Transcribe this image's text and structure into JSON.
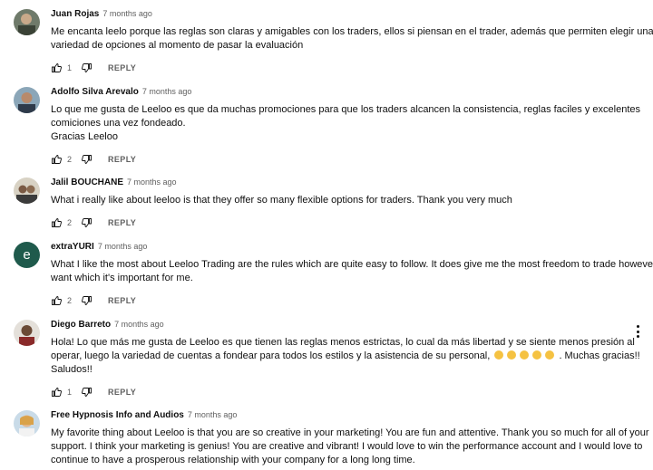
{
  "comments": [
    {
      "author": "Juan Rojas",
      "time": "7 months ago",
      "lines": [
        "Me encanta leelo porque las reglas son claras y amigables con los traders, ellos si piensan en el trader, además que permiten elegir una",
        "variedad de opciones al momento de pasar la evaluación"
      ],
      "likes": "1",
      "reply": "REPLY"
    },
    {
      "author": "Adolfo Silva Arevalo",
      "time": "7 months ago",
      "lines": [
        "Lo que me gusta de Leeloo es que da muchas promociones para que los traders alcancen la consistencia, reglas faciles y excelentes",
        "comiciones una vez fondeado.",
        "Gracias Leeloo"
      ],
      "likes": "2",
      "reply": "REPLY"
    },
    {
      "author": "Jalil BOUCHANE",
      "time": "7 months ago",
      "lines": [
        "What i really like about leeloo is that they offer so many flexible options for traders. Thank you very much"
      ],
      "likes": "2",
      "reply": "REPLY"
    },
    {
      "author": "extraYURI",
      "time": "7 months ago",
      "avatar_letter": "e",
      "lines": [
        "What I like the most about Leeloo Trading are the rules which are quite easy to follow. It does give me the most freedom to trade however I",
        "want which it's important for me."
      ],
      "likes": "2",
      "reply": "REPLY"
    },
    {
      "author": "Diego Barreto",
      "time": "7 months ago",
      "lines": [
        "Hola! Lo que más me gusta de Leeloo es que tienen las reglas menos estrictas, lo cual da más libertad y se siente menos presión al",
        "operar, luego la variedad de cuentas a fondear para todos los estilos y la asistencia de su personal,",
        "Saludos!!"
      ],
      "line2_suffix": ". Muchas gracias!!",
      "likes": "1",
      "reply": "REPLY"
    },
    {
      "author": "Free Hypnosis Info and Audios",
      "time": "7 months ago",
      "lines": [
        "My favorite thing about Leeloo is that you are so creative in your marketing! You are fun and attentive. Thank you so much for all of your",
        "support.  I think your marketing is genius! You are creative and vibrant! I would love to win the performance account and I would love to",
        "continue to have a prosperous relationship with your company for a long long time."
      ]
    }
  ],
  "icons": {
    "like": "thumbs-up-icon",
    "dislike": "thumbs-down-icon",
    "menu": "more-vert-icon",
    "emoji": "clapping-hands-emoji"
  },
  "colors": {
    "text": "#0f0f0f",
    "meta": "#606060",
    "avatar_e": "#1f5a4c"
  }
}
